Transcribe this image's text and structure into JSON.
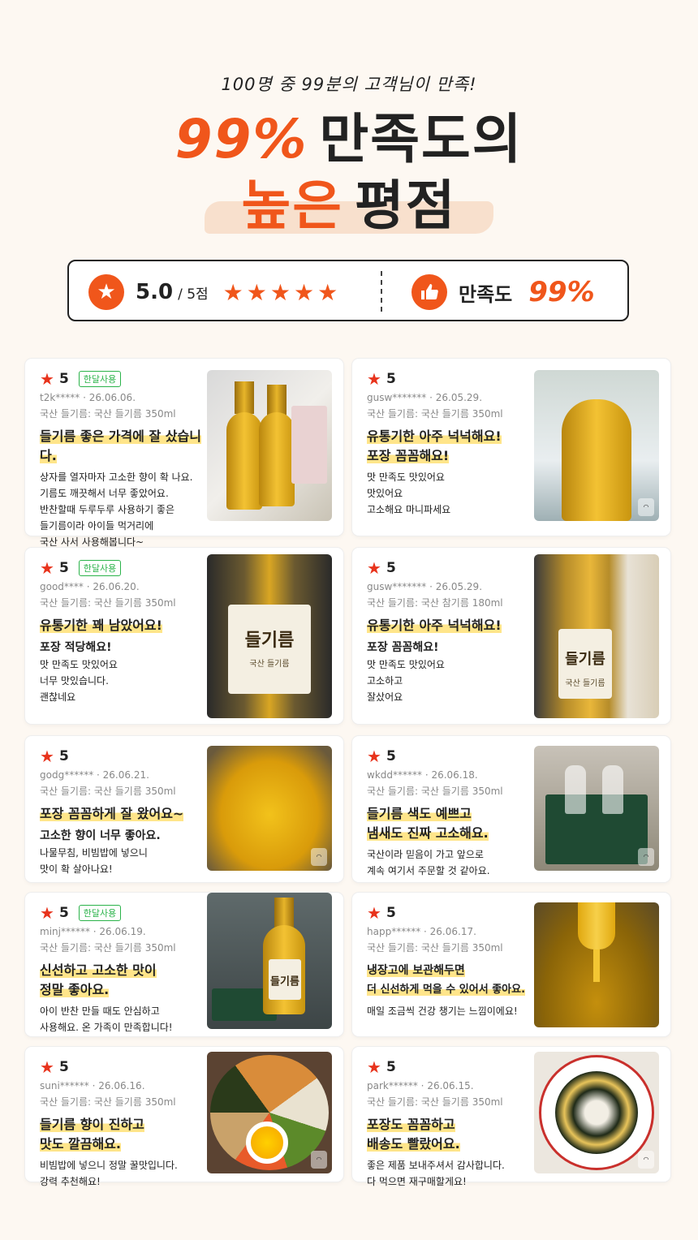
{
  "hero": {
    "subhead": "100명 중 99분의 고객님이 만족!",
    "title_pct": "99%",
    "title_rest": "만족도의",
    "title2_highlight": "높은",
    "title2_rest": "평점"
  },
  "summary": {
    "rating_icon": "star-icon",
    "rating_score": "5.0",
    "rating_max": "/ 5점",
    "rating_stars": "★★★★★",
    "satisfaction_icon": "thumbs-up-icon",
    "satisfaction_label": "만족도",
    "satisfaction_value": "99%"
  },
  "reviews": [
    {
      "score": "5",
      "badge": "한달사용",
      "user": "t2k*****",
      "date": "26.06.06.",
      "product": "국산 들기름: 국산 들기름 350ml",
      "headline": [
        "들기름 좋은 가격에 잘 샀습니다."
      ],
      "bold_lines": [],
      "lines": [
        "상자를 열자마자 고소한 향이 확 나요.",
        "기름도 깨끗해서 너무 좋았어요.",
        "반찬할때 두루두루 사용하기 좋은",
        "들기름이라 아이들 먹거리에",
        "국산 사서 사용해봅니다~"
      ],
      "photo": "oil-bottles-in-packaging-photo"
    },
    {
      "score": "5",
      "badge": "",
      "user": "gusw*******",
      "date": "26.05.29.",
      "product": "국산 들기름: 국산 들기름 350ml",
      "headline": [
        "유통기한 아주 넉넉해요!",
        "포장 꼼꼼해요!"
      ],
      "bold_lines": [],
      "lines": [
        "맛 만족도 맛있어요",
        "맛있어요",
        "고소해요 마니파세요"
      ],
      "photo": "bottle-in-fridge-photo"
    },
    {
      "score": "5",
      "badge": "한달사용",
      "user": "good****",
      "date": "26.06.20.",
      "product": "국산 들기름: 국산 들기름 350ml",
      "headline": [
        "유통기한 꽤 남았어요!"
      ],
      "bold_lines": [
        "포장 적당해요!"
      ],
      "lines": [
        "맛 만족도 맛있어요",
        "너무 맛있습니다.",
        "괜찮네요"
      ],
      "photo": "perilla-oil-bottle-label-photo",
      "photo_label": "들기름",
      "photo_sub": "국산 들기름"
    },
    {
      "score": "5",
      "badge": "",
      "user": "gusw*******",
      "date": "26.05.29.",
      "product": "국산 들기름: 국산 참기름 180ml",
      "headline": [
        "유통기한 아주 넉넉해요!"
      ],
      "bold_lines": [
        "포장 꼼꼼해요!"
      ],
      "lines": [
        "맛 만족도 맛있어요",
        "고소하고",
        "잘샀어요"
      ],
      "photo": "perilla-oil-bottle-with-bag-photo",
      "photo_label": "들기름",
      "photo_sub": "국산 들기름"
    },
    {
      "score": "5",
      "badge": "",
      "user": "godg******",
      "date": "26.06.21.",
      "product": "국산 들기름: 국산 들기름 350ml",
      "headline": [
        "포장 꼼꼼하게 잘 왔어요~"
      ],
      "bold_lines": [
        "고소한 향이 너무 좋아요."
      ],
      "lines": [
        "나물무침, 비빔밥에 넣으니",
        "맛이 확 살아나요!"
      ],
      "photo": "bottle-closeup-photo"
    },
    {
      "score": "5",
      "badge": "",
      "user": "wkdd******",
      "date": "26.06.18.",
      "product": "국산 들기름: 국산 들기름 350ml",
      "headline": [
        "들기름 색도 예쁘고",
        "냄새도 진짜 고소해요."
      ],
      "bold_lines": [],
      "lines": [
        "국산이라 믿음이 가고 앞으로",
        "계속 여기서 주문할 것 같아요."
      ],
      "photo": "gift-box-photo"
    },
    {
      "score": "5",
      "badge": "한달사용",
      "user": "minj******",
      "date": "26.06.19.",
      "product": "국산 들기름: 국산 들기름 350ml",
      "headline": [
        "신선하고 고소한 맛이",
        "정말 좋아요."
      ],
      "bold_lines": [],
      "lines": [
        "아이 반찬 만들 때도 안심하고",
        "사용해요. 온 가족이 만족합니다!"
      ],
      "photo": "bottle-on-table-photo",
      "photo_label": "들기름",
      "photo_sub": ""
    },
    {
      "score": "5",
      "badge": "",
      "user": "happ******",
      "date": "26.06.17.",
      "product": "국산 들기름: 국산 들기름 350ml",
      "headline": [
        "냉장고에 보관해두면",
        "더 신선하게 먹을 수 있어서 좋아요."
      ],
      "bold_lines": [],
      "lines": [
        "매일 조금씩 건강 챙기는 느낌이에요!"
      ],
      "photo": "oil-pouring-photo"
    },
    {
      "score": "5",
      "badge": "",
      "user": "suni******",
      "date": "26.06.16.",
      "product": "국산 들기름: 국산 들기름 350ml",
      "headline": [
        "들기름 향이 진하고",
        "맛도 깔끔해요."
      ],
      "bold_lines": [],
      "lines": [
        "비빔밥에 넣으니 정말 꿀맛입니다.",
        "강력 추천해요!"
      ],
      "photo": "bibimbap-photo"
    },
    {
      "score": "5",
      "badge": "",
      "user": "park******",
      "date": "26.06.15.",
      "product": "국산 들기름: 국산 들기름 350ml",
      "headline": [
        "포장도 꼼꼼하고",
        "배송도 빨랐어요."
      ],
      "bold_lines": [],
      "lines": [
        "좋은 제품 보내주셔서 감사합니다.",
        "다 먹으면 재구매할게요!"
      ],
      "photo": "rice-with-seaweed-photo"
    }
  ],
  "colors": {
    "accent": "#f0561b",
    "star": "#e8331c",
    "badge": "#2bb34a",
    "highlight": "#ffe58a"
  }
}
